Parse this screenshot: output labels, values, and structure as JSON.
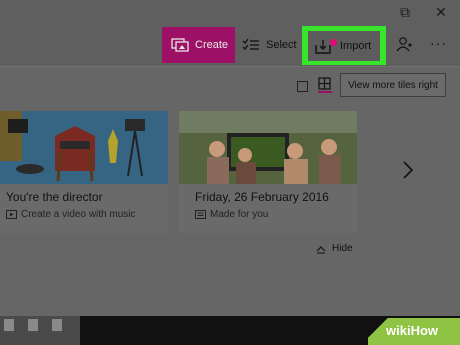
{
  "window": {
    "restore_glyph": "⧉",
    "close_glyph": "✕"
  },
  "toolbar": {
    "create_label": "Create",
    "select_label": "Select",
    "import_label": "Import",
    "more_glyph": "···"
  },
  "view": {
    "tooltip": "View more tiles right"
  },
  "tiles": [
    {
      "title": "You're the director",
      "subtitle": "Create a video with music"
    },
    {
      "title": "Friday, 26 February 2016",
      "subtitle": "Made for you"
    }
  ],
  "hide_label": "Hide",
  "watermark": {
    "text": "wikiHow",
    "color": "#8ec343"
  },
  "colors": {
    "accent": "#9c1165",
    "highlight": "#39e52a",
    "badge": "#e3097d"
  }
}
